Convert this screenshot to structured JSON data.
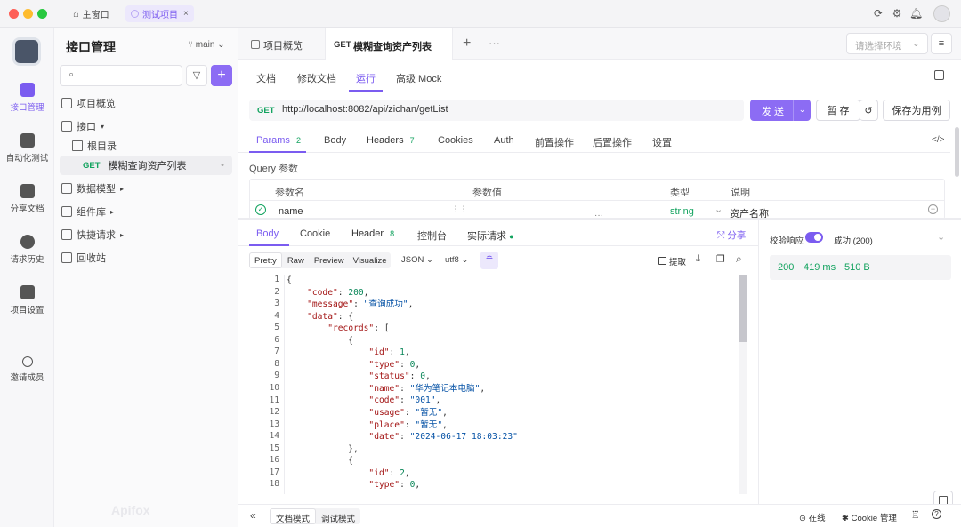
{
  "titlebar": {
    "home_tab": "主窗口",
    "project_tab": "测试项目",
    "close_glyph": "×"
  },
  "rail": {
    "items": [
      {
        "label": "接口管理",
        "icon": "api-icon",
        "active": true
      },
      {
        "label": "自动化测试",
        "icon": "automation-icon"
      },
      {
        "label": "分享文档",
        "icon": "share-doc-icon"
      },
      {
        "label": "请求历史",
        "icon": "history-icon"
      },
      {
        "label": "项目设置",
        "icon": "settings-icon"
      },
      {
        "label": "邀请成员",
        "icon": "invite-icon"
      }
    ]
  },
  "tree": {
    "title": "接口管理",
    "branch": "main",
    "items": {
      "overview": "项目概览",
      "api": "接口",
      "root": "根目录",
      "endpoint_method": "GET",
      "endpoint_name": "模糊查询资产列表",
      "models": "数据模型",
      "components": "组件库",
      "quick": "快捷请求",
      "trash": "回收站"
    },
    "watermark": "Apifox"
  },
  "tabs": {
    "overview": "项目概览",
    "active_method": "GET",
    "active_name": "模糊查询资产列表",
    "env_placeholder": "请选择环境"
  },
  "subtabs": {
    "doc": "文档",
    "edit": "修改文档",
    "run": "运行",
    "mock": "高级 Mock"
  },
  "request": {
    "method": "GET",
    "url": "http://localhost:8082/api/zichan/getList",
    "send": "发 送",
    "save": "暂 存",
    "save_case": "保存为用例"
  },
  "param_tabs": {
    "params": "Params",
    "params_count": "2",
    "body": "Body",
    "headers": "Headers",
    "headers_count": "7",
    "cookies": "Cookies",
    "auth": "Auth",
    "pre": "前置操作",
    "post": "后置操作",
    "settings": "设置"
  },
  "query": {
    "title": "Query 参数",
    "col_name": "参数名",
    "col_value": "参数值",
    "col_type": "类型",
    "col_desc": "说明",
    "row_name": "name",
    "row_type": "string",
    "row_desc": "资产名称"
  },
  "response": {
    "tabs": {
      "body": "Body",
      "cookie": "Cookie",
      "header": "Header",
      "header_count": "8",
      "console": "控制台",
      "actual": "实际请求",
      "share": "分享"
    },
    "view": {
      "pretty": "Pretty",
      "raw": "Raw",
      "preview": "Preview",
      "visualize": "Visualize",
      "format": "JSON",
      "encoding": "utf8",
      "extract": "提取"
    },
    "validate_label": "校验响应",
    "validate_status": "成功 (200)",
    "status_code": "200",
    "time": "419 ms",
    "size": "510 B"
  },
  "code_lines": [
    [
      [
        "p",
        "{"
      ]
    ],
    [
      [
        "p",
        "    "
      ],
      [
        "k",
        "\"code\""
      ],
      [
        "p",
        ": "
      ],
      [
        "n",
        "200"
      ],
      [
        "p",
        ","
      ]
    ],
    [
      [
        "p",
        "    "
      ],
      [
        "k",
        "\"message\""
      ],
      [
        "p",
        ": "
      ],
      [
        "s",
        "\"查询成功\""
      ],
      [
        "p",
        ","
      ]
    ],
    [
      [
        "p",
        "    "
      ],
      [
        "k",
        "\"data\""
      ],
      [
        "p",
        ": {"
      ]
    ],
    [
      [
        "p",
        "        "
      ],
      [
        "k",
        "\"records\""
      ],
      [
        "p",
        ": ["
      ]
    ],
    [
      [
        "p",
        "            {"
      ]
    ],
    [
      [
        "p",
        "                "
      ],
      [
        "k",
        "\"id\""
      ],
      [
        "p",
        ": "
      ],
      [
        "n",
        "1"
      ],
      [
        "p",
        ","
      ]
    ],
    [
      [
        "p",
        "                "
      ],
      [
        "k",
        "\"type\""
      ],
      [
        "p",
        ": "
      ],
      [
        "n",
        "0"
      ],
      [
        "p",
        ","
      ]
    ],
    [
      [
        "p",
        "                "
      ],
      [
        "k",
        "\"status\""
      ],
      [
        "p",
        ": "
      ],
      [
        "n",
        "0"
      ],
      [
        "p",
        ","
      ]
    ],
    [
      [
        "p",
        "                "
      ],
      [
        "k",
        "\"name\""
      ],
      [
        "p",
        ": "
      ],
      [
        "s",
        "\"华为笔记本电脑\""
      ],
      [
        "p",
        ","
      ]
    ],
    [
      [
        "p",
        "                "
      ],
      [
        "k",
        "\"code\""
      ],
      [
        "p",
        ": "
      ],
      [
        "s",
        "\"001\""
      ],
      [
        "p",
        ","
      ]
    ],
    [
      [
        "p",
        "                "
      ],
      [
        "k",
        "\"usage\""
      ],
      [
        "p",
        ": "
      ],
      [
        "s",
        "\"暂无\""
      ],
      [
        "p",
        ","
      ]
    ],
    [
      [
        "p",
        "                "
      ],
      [
        "k",
        "\"place\""
      ],
      [
        "p",
        ": "
      ],
      [
        "s",
        "\"暂无\""
      ],
      [
        "p",
        ","
      ]
    ],
    [
      [
        "p",
        "                "
      ],
      [
        "k",
        "\"date\""
      ],
      [
        "p",
        ": "
      ],
      [
        "s",
        "\"2024-06-17 18:03:23\""
      ]
    ],
    [
      [
        "p",
        "            },"
      ]
    ],
    [
      [
        "p",
        "            {"
      ]
    ],
    [
      [
        "p",
        "                "
      ],
      [
        "k",
        "\"id\""
      ],
      [
        "p",
        ": "
      ],
      [
        "n",
        "2"
      ],
      [
        "p",
        ","
      ]
    ],
    [
      [
        "p",
        "                "
      ],
      [
        "k",
        "\"type\""
      ],
      [
        "p",
        ": "
      ],
      [
        "n",
        "0"
      ],
      [
        "p",
        ","
      ]
    ]
  ],
  "footer": {
    "doc_mode": "文档模式",
    "debug_mode": "调试模式",
    "online": "在线",
    "cookie_mgr": "Cookie 管理"
  },
  "colors": {
    "accent": "#7b5cf0",
    "method_green": "#13a35f"
  }
}
